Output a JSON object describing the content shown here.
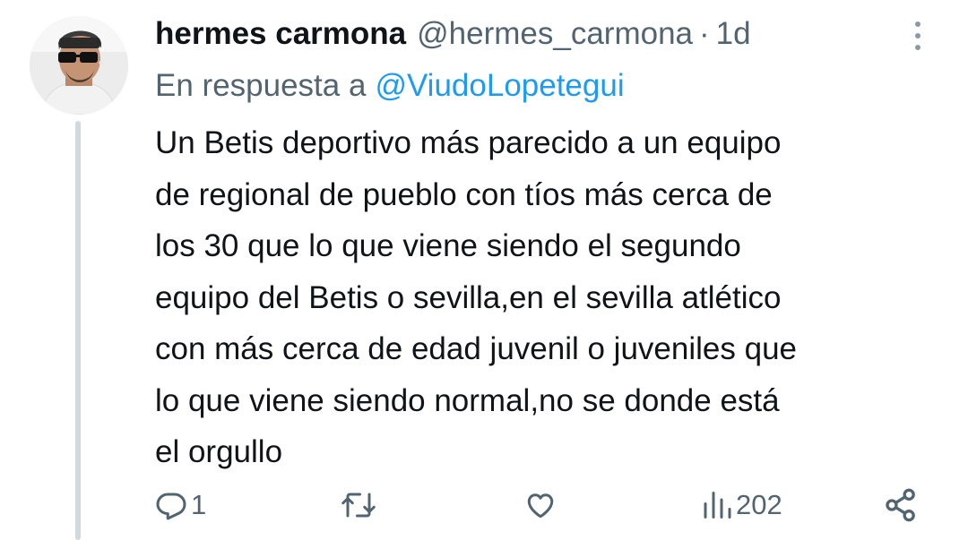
{
  "tweet": {
    "author_name": "hermes carmona",
    "author_handle": "@hermes_carmona",
    "separator": "·",
    "time": "1d",
    "reply_prefix": "En respuesta a",
    "reply_to": "@ViudoLopetegui",
    "text_lines": [
      "Un Betis deportivo más parecido a un equipo",
      "de regional de pueblo con tíos más cerca de",
      "los 30 que lo que viene siendo el segundo",
      "equipo del Betis o sevilla,en el sevilla atlético",
      "con más cerca de edad juvenil o juveniles que",
      "lo que viene siendo normal,no se donde está",
      "el orgullo"
    ]
  },
  "actions": {
    "reply_icon": "reply-icon",
    "reply_count": "1",
    "retweet_icon": "retweet-icon",
    "like_icon": "heart-icon",
    "views_icon": "views-icon",
    "views_count": "202",
    "share_icon": "share-icon"
  },
  "colors": {
    "text": "#0f1419",
    "secondary": "#536471",
    "link": "#1d9bf0",
    "thread_line": "#cfd9de"
  }
}
